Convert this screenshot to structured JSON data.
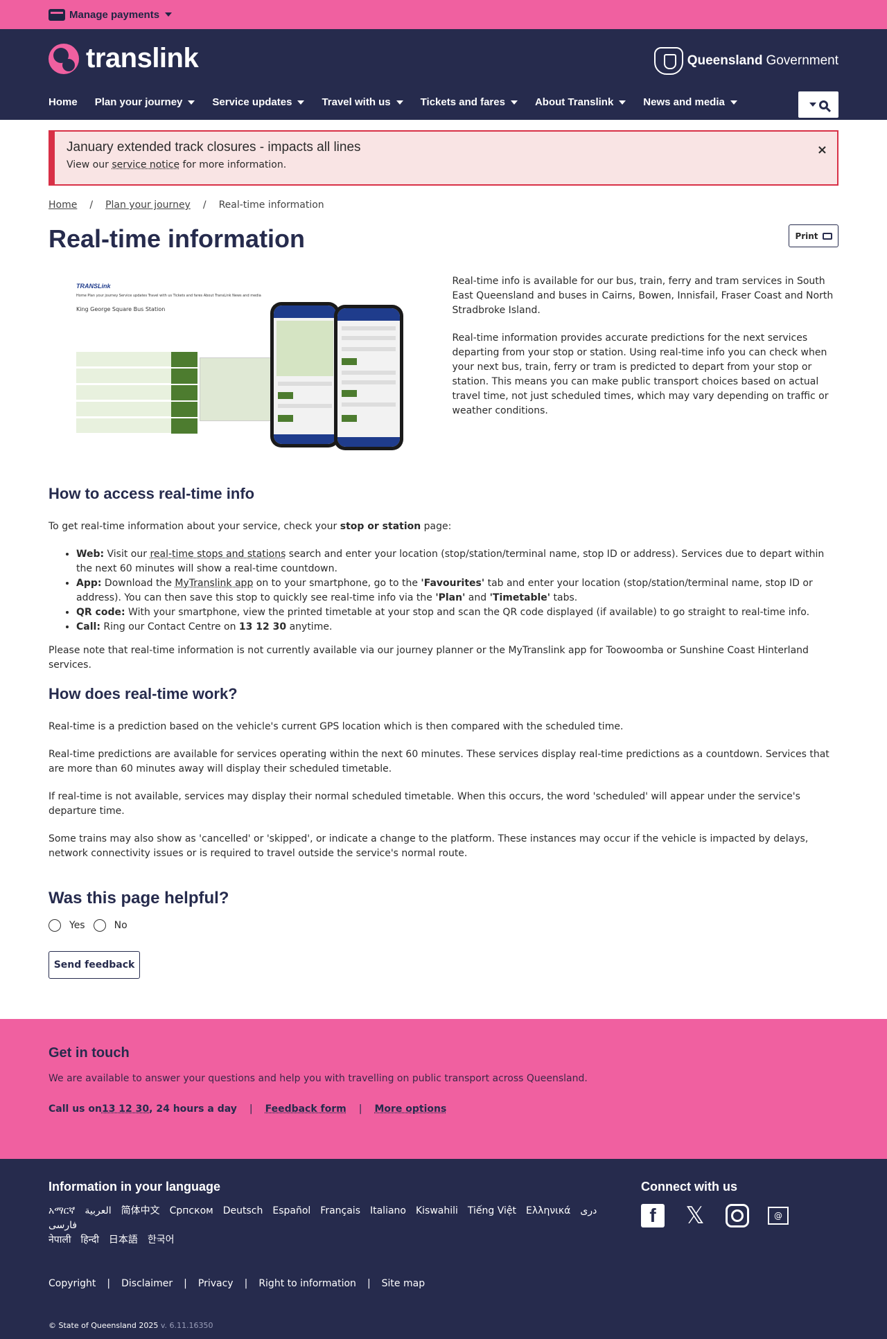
{
  "topbar": {
    "manage_payments": "Manage payments"
  },
  "header": {
    "logo_text": "translink",
    "gov_bold": "Queensland",
    "gov_light": "Government",
    "nav": [
      "Home",
      "Plan your journey",
      "Service updates",
      "Travel with us",
      "Tickets and fares",
      "About Translink",
      "News and media"
    ]
  },
  "alert": {
    "title": "January extended track closures - impacts all lines",
    "text_before": "View our ",
    "link": "service notice",
    "text_after": " for more information.",
    "close": "×"
  },
  "breadcrumb": [
    "Home",
    "Plan your journey",
    "Real-time information"
  ],
  "page": {
    "title": "Real-time information",
    "print": "Print"
  },
  "figure": {
    "logo": "TRANSLink",
    "nav": "Home   Plan your journey   Service updates   Travel with us   Tickets and fares   About TransLink   News and media",
    "heading": "King George Square Bus Station"
  },
  "intro": [
    "Real-time info is available for our bus, train, ferry and tram services in South East Queensland and buses in Cairns, Bowen, Innisfail, Fraser Coast and North Stradbroke Island.",
    "Real-time information provides accurate predictions for the next services departing from your stop or station. Using real-time info you can check when your next bus, train, ferry or tram is predicted to depart from your stop or station. This means you can make public transport choices based on actual travel time, not just scheduled times, which may vary depending on traffic or weather conditions."
  ],
  "access": {
    "heading": "How to access real-time info",
    "lead_before": "To get real-time information about your service, check your ",
    "lead_bold": "stop or station",
    "lead_after": " page:",
    "web_label": "Web:",
    "web_before": " Visit our ",
    "web_link": "real-time stops and stations",
    "web_after": " search and enter your location (stop/station/terminal name, stop ID or address). Services due to depart within the next 60 minutes will show a real-time countdown.",
    "app_label": "App:",
    "app_before": " Download the ",
    "app_link": "MyTranslink app",
    "app_mid1": " on to your smartphone, go to the ",
    "app_fav": "'Favourites'",
    "app_mid2": " tab and enter your location (stop/station/terminal name, stop ID or address). You can then save this stop to quickly see real-time info via the ",
    "app_plan": "'Plan'",
    "app_and": " and ",
    "app_timetable": "'Timetable'",
    "app_end": " tabs.",
    "qr_label": "QR code:",
    "qr_text": " With your smartphone, view the printed timetable at your stop and scan the QR code displayed (if available) to go straight to real-time info.",
    "call_label": "Call:",
    "call_before": " Ring our Contact Centre on ",
    "call_number": "13 12 30",
    "call_after": " anytime.",
    "note": "Please note that real-time information is not currently available via our journey planner or the MyTranslink app for Toowoomba or Sunshine Coast Hinterland services."
  },
  "works": {
    "heading": "How does real-time work?",
    "paragraphs": [
      "Real-time is a prediction based on the vehicle's current GPS location which is then compared with the scheduled time.",
      "Real-time predictions are available for services operating within the next 60 minutes. These services display real-time predictions as a countdown. Services that are more than 60 minutes away will display their scheduled timetable.",
      "If real-time is not available, services may display their normal scheduled timetable. When this occurs, the word 'scheduled' will appear under the service's departure time.",
      "Some trains may also show as 'cancelled' or 'skipped', or indicate a change to the platform. These instances may occur if the vehicle is impacted by delays, network connectivity issues or is required to travel outside the service's normal route."
    ]
  },
  "helpful": {
    "heading": "Was this page helpful?",
    "yes": "Yes",
    "no": "No",
    "send": "Send feedback"
  },
  "touch": {
    "heading": "Get in touch",
    "text": "We are available to answer your questions and help you with travelling on public transport across Queensland.",
    "call_before": "Call us on ",
    "call_number": "13 12 30",
    "call_after": ", 24 hours a day",
    "sep": "|",
    "feedback": "Feedback form",
    "more": "More options"
  },
  "footer": {
    "lang_heading": "Information in your language",
    "languages": [
      "አማርኛ",
      "العربية",
      "简体中文",
      "Српском",
      "Deutsch",
      "Español",
      "Français",
      "Italiano",
      "Kiswahili",
      "Tiếng Việt",
      "Ελληνικά",
      "دری",
      "فارسی",
      "नेपाली",
      "हिन्दी",
      "日本語",
      "한국어"
    ],
    "connect_heading": "Connect with us",
    "social": [
      "facebook-icon",
      "x-icon",
      "instagram-icon",
      "email-icon"
    ],
    "links": [
      "Copyright",
      "Disclaimer",
      "Privacy",
      "Right to information",
      "Site map"
    ],
    "sep": "|",
    "copyright": "© State of Queensland 2025",
    "version": "v. 6.11.16350"
  },
  "colors": {
    "pink": "#f060a0",
    "navy": "#262b4d",
    "alert_red": "#d83046"
  }
}
